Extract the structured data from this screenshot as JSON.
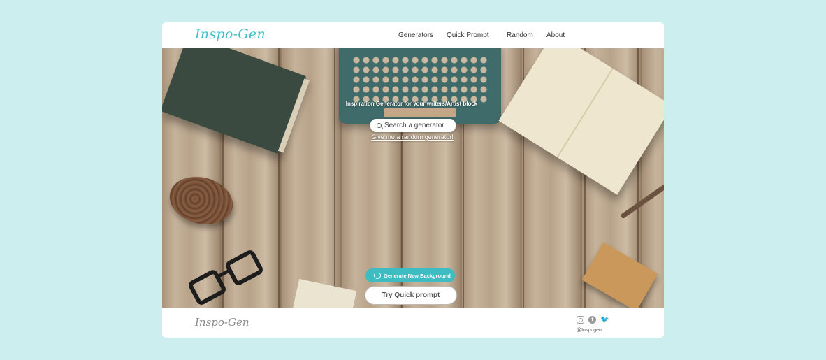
{
  "header": {
    "logo": "Inspo-Gen",
    "nav": [
      "Generators",
      "Quick Prompt",
      "Random",
      "About"
    ]
  },
  "hero": {
    "tagline": "Inspiration Generator for your writers/Artist block",
    "search_placeholder": "Search a generator",
    "random_link": "Give me a random generator!",
    "generate_bg_label": "Generate New Background",
    "quick_prompt_label": "Try Quick prompt"
  },
  "footer": {
    "logo": "Inspo-Gen",
    "handle": "@Inspogen",
    "social_icons": [
      "instagram-icon",
      "tumblr-icon",
      "twitter-icon"
    ]
  },
  "colors": {
    "page_bg": "#cdeeee",
    "accent": "#3bbfc4"
  }
}
